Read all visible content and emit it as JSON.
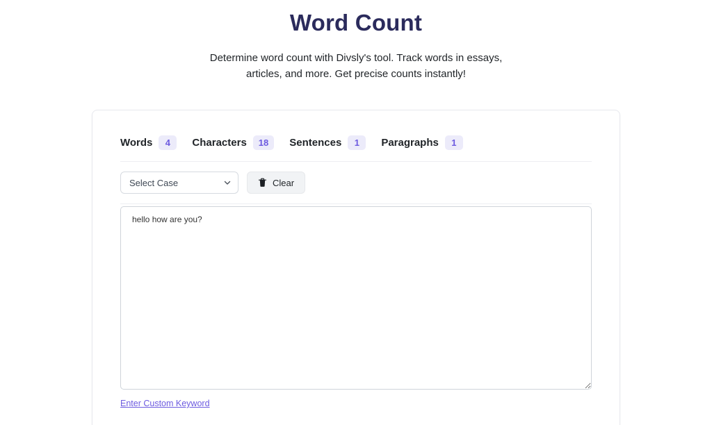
{
  "page": {
    "title": "Word Count",
    "subtitle_line1": "Determine word count with Divsly's tool. Track words in essays,",
    "subtitle_line2": "articles, and more. Get precise counts instantly!"
  },
  "stats": [
    {
      "label": "Words",
      "value": "4"
    },
    {
      "label": "Characters",
      "value": "18"
    },
    {
      "label": "Sentences",
      "value": "1"
    },
    {
      "label": "Paragraphs",
      "value": "1"
    }
  ],
  "controls": {
    "select_case_label": "Select Case",
    "clear_label": "Clear"
  },
  "editor": {
    "text": "hello how are you?"
  },
  "footer": {
    "custom_keyword_link": "Enter Custom Keyword"
  },
  "colors": {
    "title": "#2b2b5c",
    "badge_bg": "#ecebfa",
    "badge_text": "#6d5be0",
    "link": "#6d5be0"
  }
}
